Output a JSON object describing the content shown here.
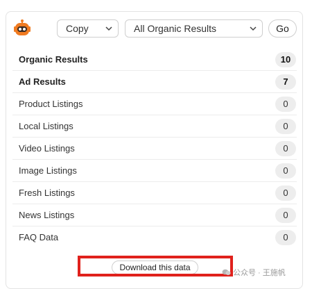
{
  "toolbar": {
    "copy_select": "Copy",
    "results_select": "All Organic Results",
    "go_label": "Go"
  },
  "rows": [
    {
      "label": "Organic Results",
      "count": "10",
      "bold": true
    },
    {
      "label": "Ad Results",
      "count": "7",
      "bold": true
    },
    {
      "label": "Product Listings",
      "count": "0",
      "bold": false
    },
    {
      "label": "Local Listings",
      "count": "0",
      "bold": false
    },
    {
      "label": "Video Listings",
      "count": "0",
      "bold": false
    },
    {
      "label": "Image Listings",
      "count": "0",
      "bold": false
    },
    {
      "label": "Fresh Listings",
      "count": "0",
      "bold": false
    },
    {
      "label": "News Listings",
      "count": "0",
      "bold": false
    },
    {
      "label": "FAQ Data",
      "count": "0",
      "bold": false
    }
  ],
  "download": {
    "label": "Download this data"
  },
  "watermark": {
    "text": "公众号 · 王施帆"
  },
  "colors": {
    "brand": "#f07b21",
    "highlight": "#e0211c"
  },
  "icons": {
    "logo": "robot-logo-icon",
    "dropdown": "chevron-down-icon",
    "watermark": "wechat-icon"
  }
}
